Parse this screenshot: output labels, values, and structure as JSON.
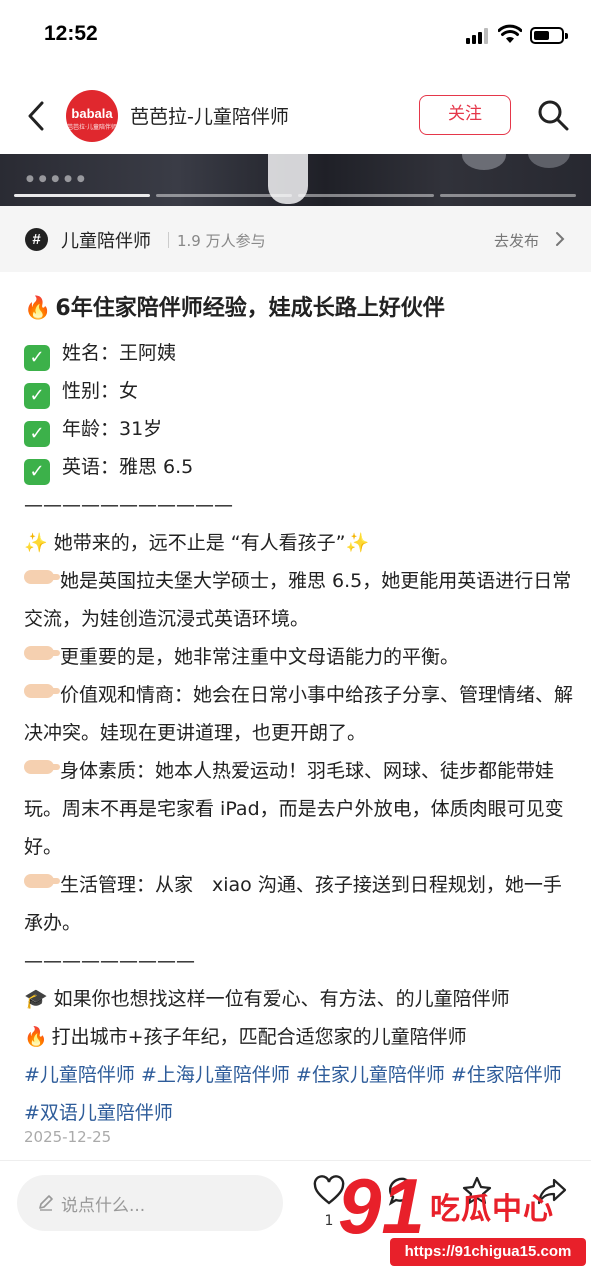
{
  "status_bar": {
    "time": "12:52"
  },
  "header": {
    "avatar_brand": "babala",
    "avatar_subtitle": "芭芭拉·儿童陪伴师",
    "account_name": "芭芭拉-儿童陪伴师",
    "follow_label": "关注"
  },
  "topic": {
    "name": "儿童陪伴师",
    "participants": "1.9 万人参与",
    "go_publish": "去发布"
  },
  "post": {
    "title": "6年住家陪伴师经验，娃成长路上好伙伴",
    "fields": [
      "姓名：王阿姨",
      "性别：女",
      "年龄：31岁",
      "英语：雅思 6.5"
    ],
    "divider1": "———————————",
    "intro": "她带来的，远不止是 “有人看孩子”",
    "points": [
      "她是英国拉夫堡大学硕士，雅思 6.5，她更能用英语进行日常交流，为娃创造沉浸式英语环境。",
      "更重要的是，她非常注重中文母语能力的平衡。",
      "价值观和情商：她会在日常小事中给孩子分享、管理情绪、解决冲突。娃现在更讲道理，也更开朗了。",
      "身体素质：她本人热爱运动！羽毛球、网球、徒步都能带娃玩。周末不再是宅家看 iPad，而是去户外放电，体质肉眼可见变好。",
      "生活管理：从家　xiao 沟通、孩子接送到日程规划，她一手承办。"
    ],
    "divider2": "—————————",
    "cta1": "如果你也想找这样一位有爱心、有方法、的儿童陪伴师",
    "cta2": "打出城市+孩子年纪，匹配合适您家的儿童陪伴师",
    "hashtags": "#儿童陪伴师 #上海儿童陪伴师 #住家儿童陪伴师 #住家陪伴师 #双语儿童陪伴师",
    "date": "2025-12-25"
  },
  "bottom_bar": {
    "comment_placeholder": "说点什么...",
    "like_count": "1"
  },
  "watermark": {
    "number": "91",
    "text": "吃瓜中心",
    "url": "https://91chigua15.com"
  }
}
